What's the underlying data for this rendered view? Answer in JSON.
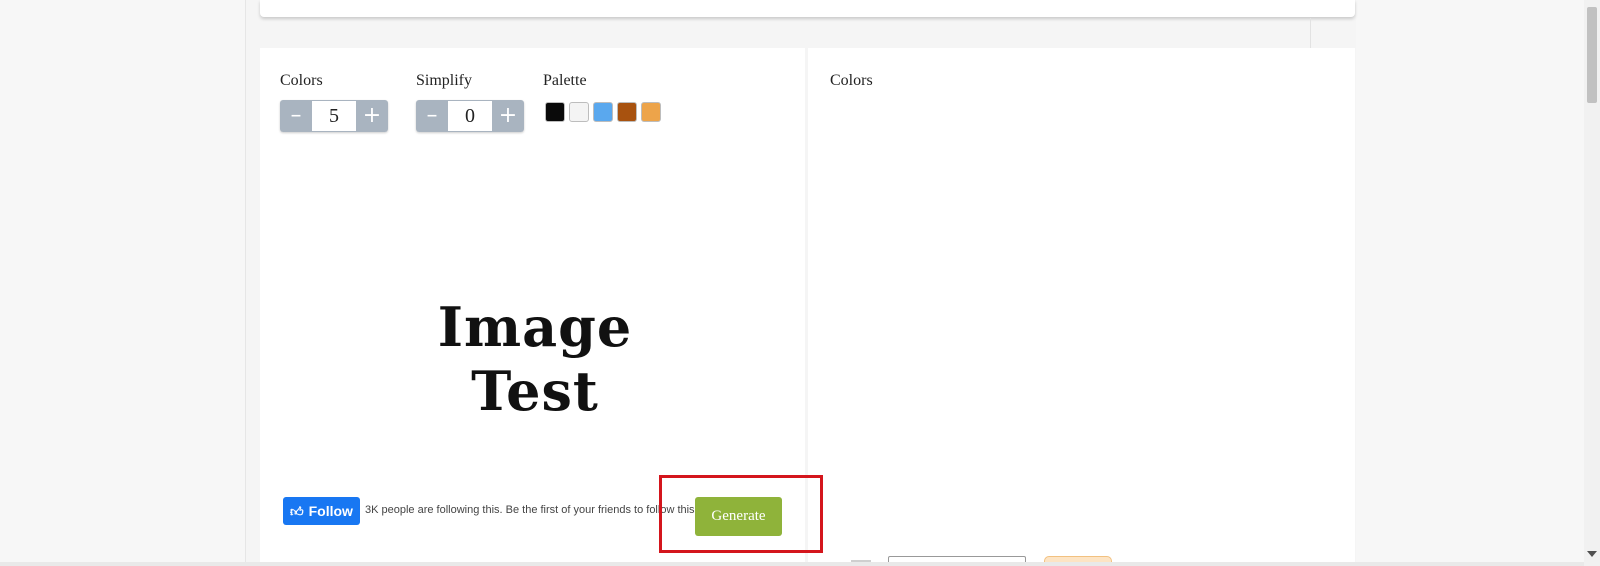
{
  "controls": {
    "colors": {
      "label": "Colors",
      "value": "5",
      "minus": "–",
      "plus": "+"
    },
    "simplify": {
      "label": "Simplify",
      "value": "0",
      "minus": "–",
      "plus": "+"
    },
    "palette": {
      "label": "Palette",
      "swatches": [
        "#0a0a0a",
        "#f4f4f4",
        "#5aa8ee",
        "#a8520f",
        "#eda44a"
      ]
    }
  },
  "preview": {
    "text": "Image Test"
  },
  "right_panel": {
    "label": "Colors"
  },
  "facebook": {
    "follow_label": "Follow",
    "follow_text": "3K people are following this. Be the first of your friends to follow this."
  },
  "generate": {
    "label": "Generate"
  },
  "colors": {
    "accent_green": "#8fb33a",
    "highlight_red": "#d4151c",
    "fb_blue": "#1877f2",
    "stepper_gray": "#a9b4c0"
  }
}
